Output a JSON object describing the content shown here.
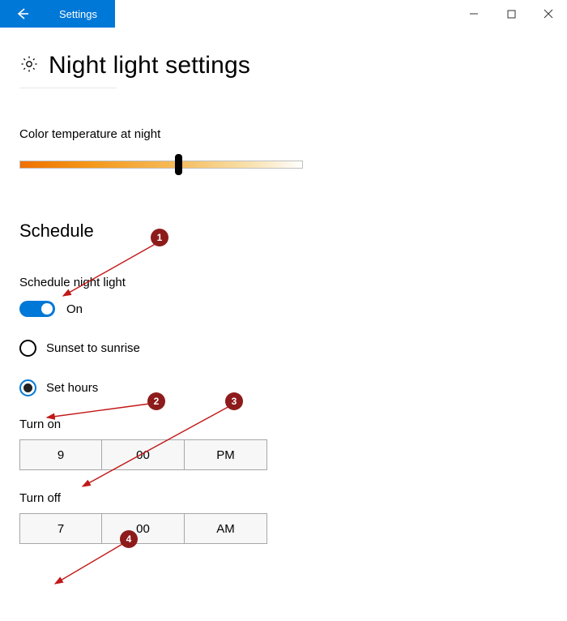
{
  "window": {
    "app_title": "Settings"
  },
  "page": {
    "title": "Night light settings"
  },
  "color_temp": {
    "label": "Color temperature at night",
    "slider_percent": 55
  },
  "schedule": {
    "title": "Schedule",
    "toggle_label": "Schedule night light",
    "toggle_state": "On",
    "option_sunset": "Sunset to sunrise",
    "option_set_hours": "Set hours",
    "turn_on": {
      "label": "Turn on",
      "hour": "9",
      "minute": "00",
      "ampm": "PM"
    },
    "turn_off": {
      "label": "Turn off",
      "hour": "7",
      "minute": "00",
      "ampm": "AM"
    }
  },
  "annotations": {
    "b1": "1",
    "b2": "2",
    "b3": "3",
    "b4": "4"
  }
}
